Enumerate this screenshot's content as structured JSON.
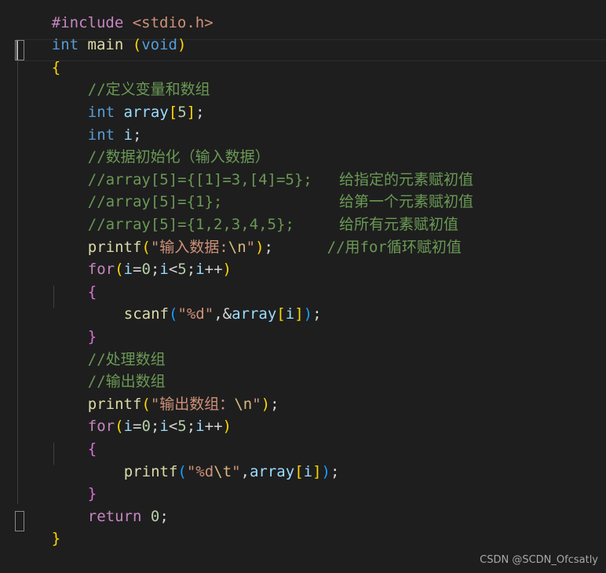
{
  "editor": {
    "l0": {
      "pre": "#include",
      "sp": " ",
      "hdr": "<stdio.h>"
    },
    "l1": {
      "kw": "int",
      "sp": " ",
      "fn": "main",
      "sp2": " ",
      "lp": "(",
      "param": "void",
      "rp": ")"
    },
    "l2": {
      "brace": "{"
    },
    "l3": {
      "comment": "//定义变量和数组"
    },
    "l4": {
      "kw": "int",
      "sp": " ",
      "name": "array",
      "lb": "[",
      "num": "5",
      "rb": "]",
      "semi": ";"
    },
    "l5": {
      "kw": "int",
      "sp": " ",
      "name": "i",
      "semi": ";"
    },
    "l6": {
      "comment": "//数据初始化（输入数据）"
    },
    "l7": {
      "comment": "//array[5]={[1]=3,[4]=5};   给指定的元素赋初值"
    },
    "l8": {
      "comment": "//array[5]={1};             给第一个元素赋初值"
    },
    "l9": {
      "comment": "//array[5]={1,2,3,4,5};     给所有元素赋初值"
    },
    "l10": {
      "fn": "printf",
      "lp": "(",
      "str": "\"输入数据:",
      "esc": "\\n",
      "strend": "\"",
      "rp": ")",
      "semi": ";",
      "gap": "      ",
      "comment": "//用for循环赋初值"
    },
    "l11": {
      "kw": "for",
      "lp": "(",
      "v1": "i",
      "eq1": "=",
      "n0": "0",
      "s1": ";",
      "v2": "i",
      "lt": "<",
      "n5": "5",
      "s2": ";",
      "v3": "i",
      "inc": "++",
      "rp": ")"
    },
    "l12": {
      "brace": "{"
    },
    "l13": {
      "fn": "scanf",
      "lp": "(",
      "str": "\"%d\"",
      "comma": ",&",
      "name": "array",
      "lb": "[",
      "idx": "i",
      "rb": "]",
      "rp": ")",
      "semi": ";"
    },
    "l14": {
      "brace": "}"
    },
    "l15": {
      "comment": "//处理数组"
    },
    "l16": {
      "comment": "//输出数组"
    },
    "l17": {
      "fn": "printf",
      "lp": "(",
      "str": "\"输出数组：",
      "esc": "\\n",
      "strend": "\"",
      "rp": ")",
      "semi": ";"
    },
    "l18": {
      "kw": "for",
      "lp": "(",
      "v1": "i",
      "eq1": "=",
      "n0": "0",
      "s1": ";",
      "v2": "i",
      "lt": "<",
      "n5": "5",
      "s2": ";",
      "v3": "i",
      "inc": "++",
      "rp": ")"
    },
    "l19": {
      "brace": "{"
    },
    "l20": {
      "fn": "printf",
      "lp": "(",
      "str": "\"%d",
      "esc": "\\t",
      "strend": "\"",
      "comma": ",",
      "name": "array",
      "lb": "[",
      "idx": "i",
      "rb": "]",
      "rp": ")",
      "semi": ";"
    },
    "l21": {
      "brace": "}"
    },
    "l22": {
      "kw": "return",
      "sp": " ",
      "num": "0",
      "semi": ";"
    },
    "l23": {
      "brace": "}"
    }
  },
  "watermark": "CSDN @SCDN_Ofcsatly",
  "colors": {
    "background": "#1e1e1e",
    "keyword": "#569cd6",
    "control": "#c586c0",
    "function": "#dcdcaa",
    "variable": "#9cdcfe",
    "string": "#ce9178",
    "number": "#b5cea8",
    "comment": "#6a9955"
  }
}
